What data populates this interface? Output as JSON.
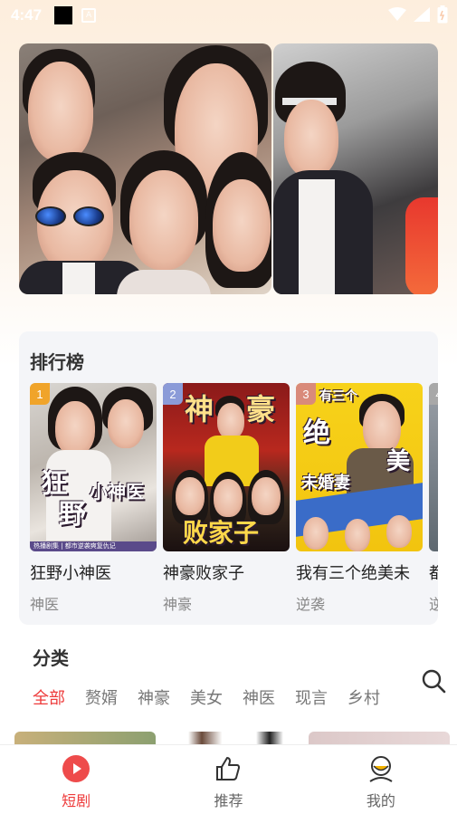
{
  "status_bar": {
    "time": "4:47",
    "a_label": "A"
  },
  "ranking": {
    "title": "排行榜",
    "items": [
      {
        "rank": "1",
        "name": "狂野小神医",
        "tag": "神医",
        "badge_color": "#f0a42a",
        "poster_title_1": "狂",
        "poster_title_2": "野",
        "poster_title_3": "小神医",
        "poster_caption": "热播剧集 | 都市逆袭爽复仇记"
      },
      {
        "rank": "2",
        "name": "神豪败家子",
        "tag": "神豪",
        "badge_color": "#8b9bd8",
        "poster_title_1": "神",
        "poster_title_2": "豪",
        "poster_title_3": "败家子"
      },
      {
        "rank": "3",
        "name": "我有三个绝美未",
        "tag": "逆袭",
        "badge_color": "#d98a7a",
        "poster_title_1": "有三个",
        "poster_title_2": "绝",
        "poster_title_3": "美",
        "poster_title_4": "未婚妻"
      },
      {
        "rank": "4",
        "name": "都",
        "tag": "逆"
      }
    ]
  },
  "category": {
    "title": "分类",
    "tabs": [
      "全部",
      "赘婿",
      "神豪",
      "美女",
      "神医",
      "现言",
      "乡村"
    ],
    "active_index": 0
  },
  "bottom_nav": {
    "items": [
      {
        "label": "短剧",
        "icon": "play-circle-icon",
        "active": true
      },
      {
        "label": "推荐",
        "icon": "thumbs-up-icon",
        "active": false
      },
      {
        "label": "我的",
        "icon": "user-icon",
        "active": false
      }
    ]
  },
  "colors": {
    "accent": "#ee3b3b",
    "panel_bg": "#f4f5f8"
  }
}
